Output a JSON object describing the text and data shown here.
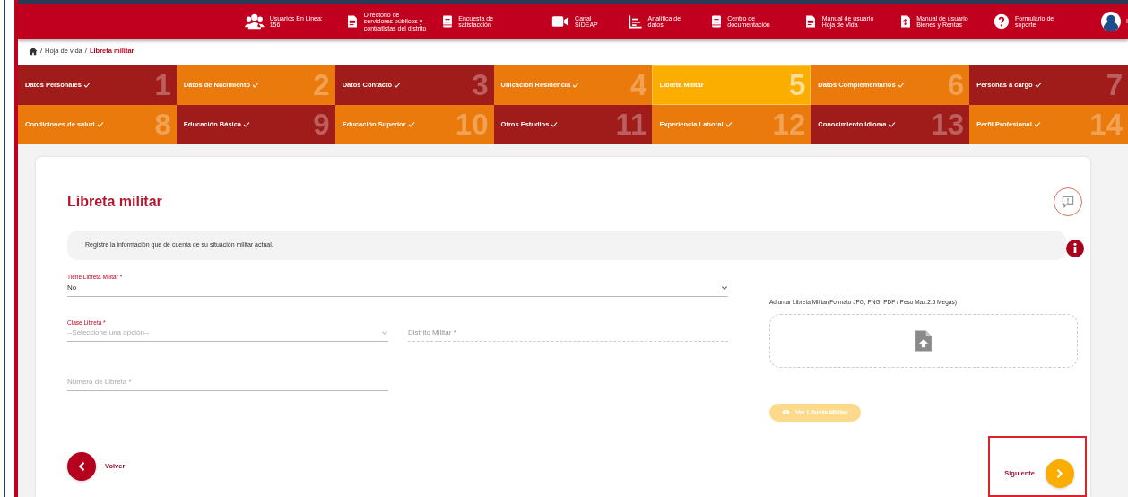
{
  "header": {
    "items": [
      {
        "kind": "users",
        "label": "Usuarios En Linea: 156"
      },
      {
        "kind": "doc",
        "label": "Directorio de servidores públicos y contratistas del distrito"
      },
      {
        "kind": "book",
        "label": "Encuesta de satisfacción"
      },
      {
        "kind": "video",
        "label": "Canal SIDEAP"
      },
      {
        "kind": "chart",
        "label": "Analítica de datos"
      },
      {
        "kind": "book",
        "label": "Centro de documentación"
      },
      {
        "kind": "doc",
        "label": "Manual de usuario Hoja de Vida"
      },
      {
        "kind": "money",
        "label": "Manual de usuario Bienes y Rentas"
      },
      {
        "kind": "help",
        "label": "Formulario de soporte"
      },
      {
        "kind": "avatar",
        "label": "I"
      }
    ]
  },
  "breadcrumb": [
    {
      "kind": "home"
    },
    {
      "separator": "/",
      "label": "Hoja de vida"
    },
    {
      "separator": "/",
      "label": "Libreta militar"
    }
  ],
  "steps": [
    {
      "label": "Datos Personales",
      "number": "1",
      "color": "#a01c1a",
      "completed": true,
      "selected": false
    },
    {
      "label": "Datos de Nacimiento",
      "number": "2",
      "color": "#eb7a0c",
      "completed": true,
      "selected": false
    },
    {
      "label": "Datos Contacto",
      "number": "3",
      "color": "#a01c1a",
      "completed": true,
      "selected": false
    },
    {
      "label": "Ubicación Residencia",
      "number": "4",
      "color": "#eb7a0c",
      "completed": true,
      "selected": false
    },
    {
      "label": "Libreta Militar",
      "number": "5",
      "color": "#fcae00",
      "completed": false,
      "selected": true
    },
    {
      "label": "Datos Complementarios",
      "number": "6",
      "color": "#eb7a0c",
      "completed": true,
      "selected": false
    },
    {
      "label": "Personas a cargo",
      "number": "7",
      "color": "#a01c1a",
      "completed": true,
      "selected": false
    },
    {
      "label": "Condiciones de salud",
      "number": "8",
      "color": "#eb7a0c",
      "completed": true,
      "selected": false
    },
    {
      "label": "Educación Básica",
      "number": "9",
      "color": "#a01c1a",
      "completed": true,
      "selected": false
    },
    {
      "label": "Educación Superior",
      "number": "10",
      "color": "#eb7a0c",
      "completed": true,
      "selected": false
    },
    {
      "label": "Otros Estudios",
      "number": "11",
      "color": "#a01c1a",
      "completed": true,
      "selected": false
    },
    {
      "label": "Experiencia Laboral",
      "number": "12",
      "color": "#eb7a0c",
      "completed": true,
      "selected": false
    },
    {
      "label": "Conocimiento Idioma",
      "number": "13",
      "color": "#a01c1a",
      "completed": true,
      "selected": false
    },
    {
      "label": "Perfil Profesional",
      "number": "14",
      "color": "#eb7a0c",
      "completed": true,
      "selected": false
    }
  ],
  "form": {
    "title": "Libreta militar",
    "info": "Registre la información que dé cuenta de su situación militar actual.",
    "fields": [
      {
        "kind": "select",
        "label": "Tiene Libreta Militar *",
        "value": "No",
        "disabled": false
      },
      {
        "kind": "select",
        "label": "Clase Libreta *",
        "placeholder": "--Seleccione una opción--",
        "disabled": false
      },
      {
        "kind": "input",
        "placeholder": "Distrito Militar *",
        "disabled": true
      },
      {
        "kind": "input",
        "placeholder": "Número de Libreta *",
        "disabled": false
      }
    ],
    "upload": {
      "label": "Adjuntar Libreta Militar(Formato JPG, PNG, PDF / Peso Max.2.5 Megas)"
    },
    "view_button": {
      "label": "Ver Libreta Militar",
      "disabled": true
    },
    "back": {
      "label": "Volver"
    },
    "next": {
      "label": "Siguiente",
      "highlighted": true
    }
  }
}
